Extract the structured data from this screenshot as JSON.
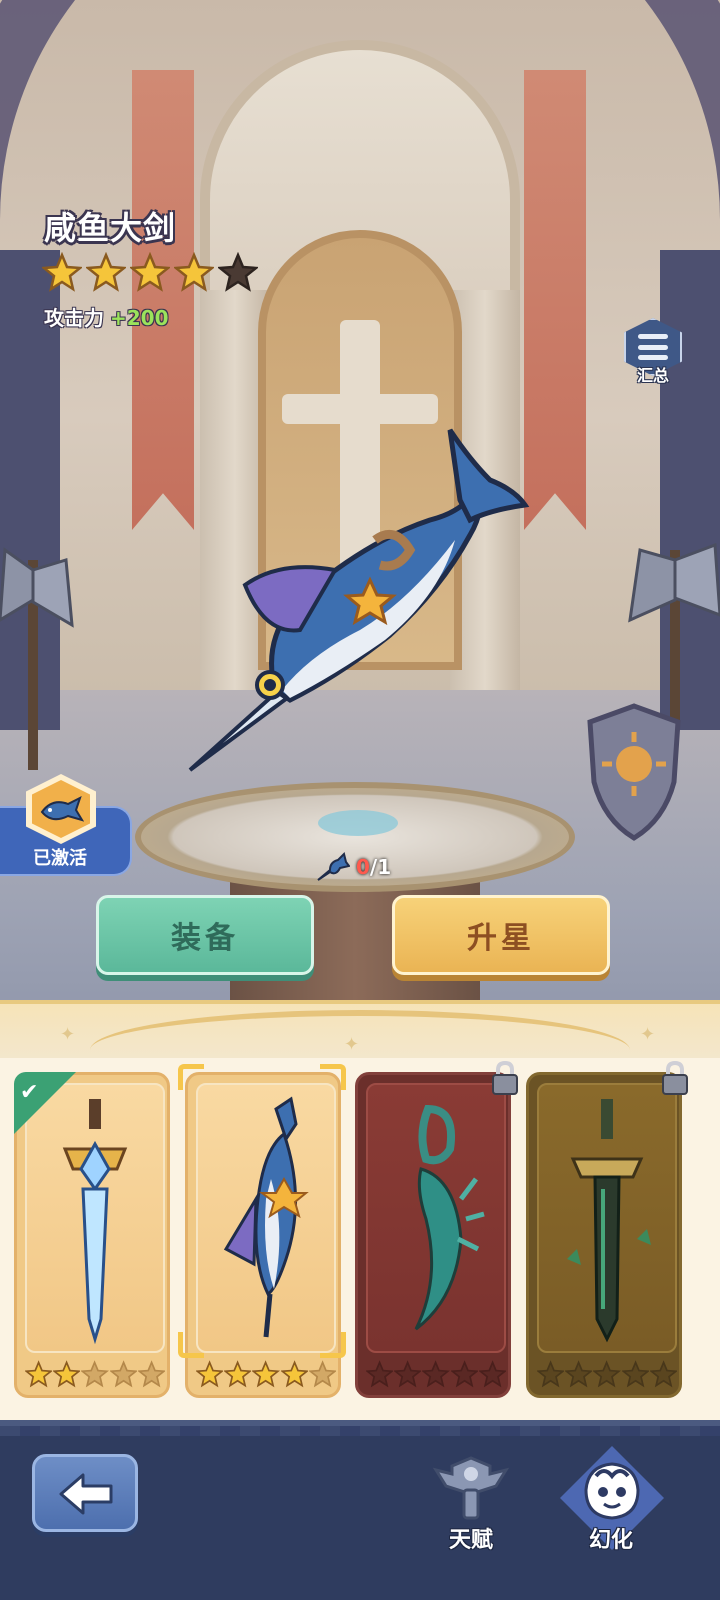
{
  "weapon": {
    "name": "咸鱼大剑",
    "stars_filled": 4,
    "stars_total": 5,
    "attack_label": "攻击力",
    "attack_bonus": "+200"
  },
  "summary_button": {
    "label": "汇总",
    "icon": "list-icon"
  },
  "activated_badge": {
    "label": "已激活",
    "icon": "fish-badge-icon"
  },
  "material": {
    "have": "0",
    "need": "/1",
    "icon": "swordfish-icon"
  },
  "actions": {
    "equip_label": "装备",
    "star_up_label": "升星"
  },
  "cards": [
    {
      "name": "ice-sword",
      "stars_filled": 2,
      "stars_total": 5,
      "equipped": true,
      "selected": false,
      "locked": false
    },
    {
      "name": "swordfish-greatsword",
      "stars_filled": 4,
      "stars_total": 5,
      "equipped": false,
      "selected": true,
      "locked": false
    },
    {
      "name": "seaweed-blade",
      "stars_filled": 0,
      "stars_total": 5,
      "equipped": false,
      "selected": false,
      "locked": true
    },
    {
      "name": "jade-greatsword",
      "stars_filled": 0,
      "stars_total": 5,
      "equipped": false,
      "selected": false,
      "locked": true
    }
  ],
  "nav": {
    "back_icon": "back-arrow-icon",
    "items": [
      {
        "label": "天赋",
        "icon": "talent-icon",
        "active": false
      },
      {
        "label": "幻化",
        "icon": "illusion-icon",
        "active": true
      }
    ]
  },
  "colors": {
    "star_gold": "#f5c53a",
    "star_empty": "#4a3a33",
    "bonus_green": "#9be35b",
    "equip_green": "#5bb89a",
    "star_up_gold": "#eab454",
    "material_red": "#ff5a4e"
  }
}
